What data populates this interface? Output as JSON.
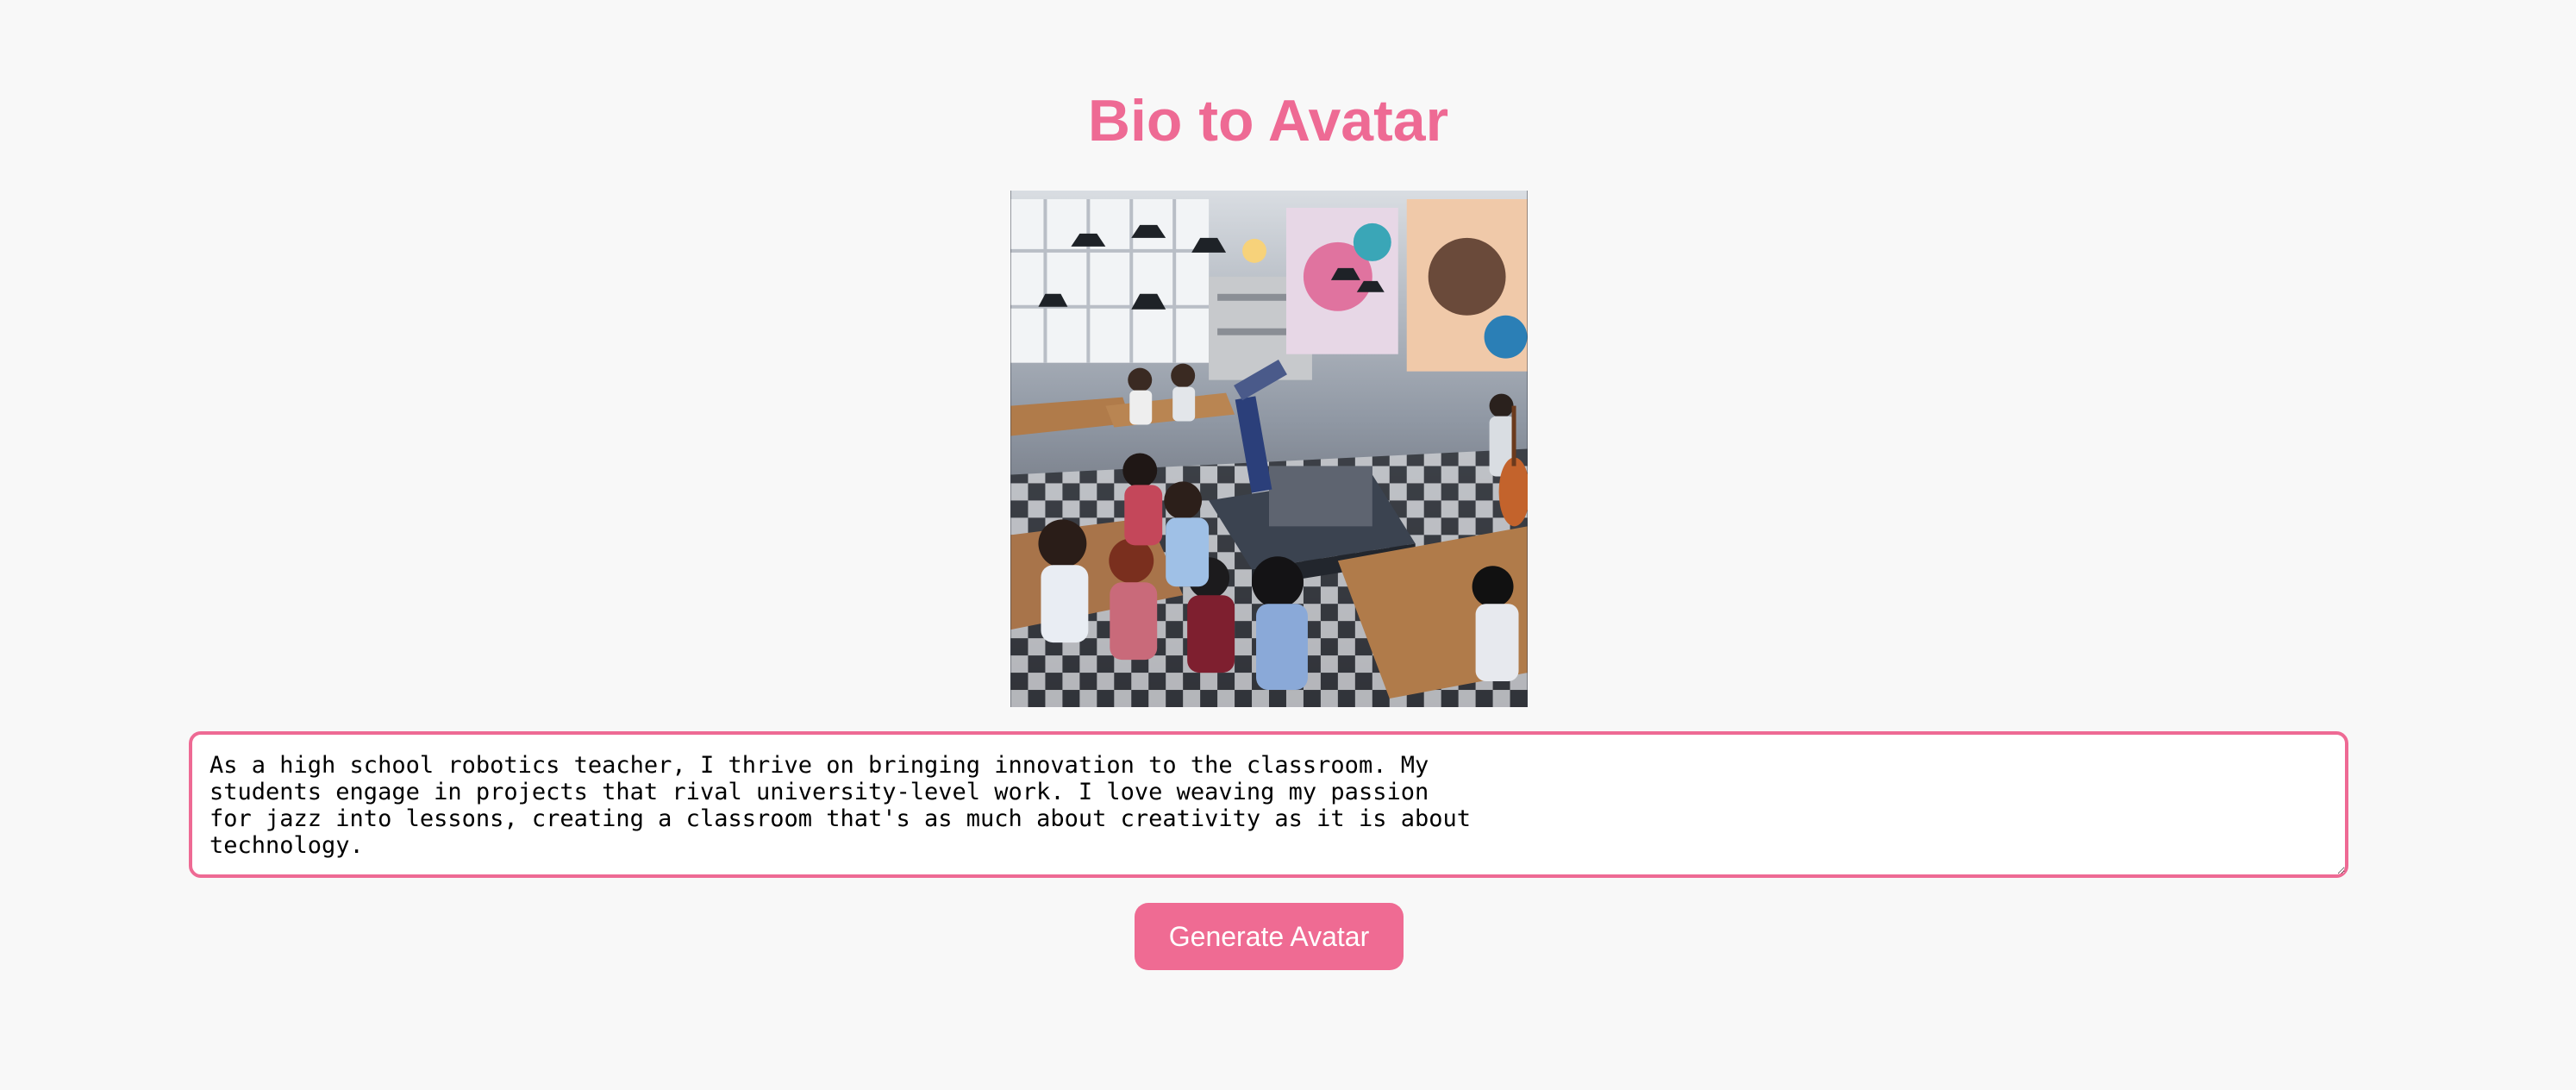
{
  "page": {
    "title": "Bio to Avatar",
    "accent_color": "#ee6a94"
  },
  "avatar": {
    "alt": "Generated avatar: classroom with robotic arm, students at desks and jazz-themed posters"
  },
  "bio": {
    "value": "As a high school robotics teacher, I thrive on bringing innovation to the classroom. My\nstudents engage in projects that rival university-level work. I love weaving my passion\nfor jazz into lessons, creating a classroom that's as much about creativity as it is about\ntechnology."
  },
  "actions": {
    "generate_label": "Generate Avatar"
  }
}
